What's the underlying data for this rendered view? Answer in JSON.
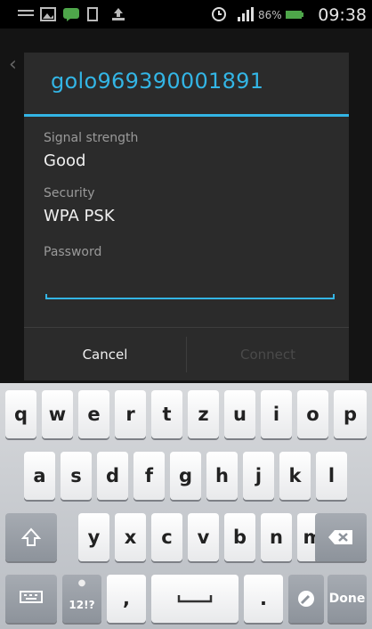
{
  "status_bar": {
    "battery_percent": "86%",
    "time": "09:38",
    "icons": [
      "notification-icon",
      "image-icon",
      "chat-icon",
      "sim-icon",
      "upload-icon",
      "alarm-icon",
      "signal-icon",
      "battery-icon"
    ]
  },
  "dialog": {
    "title": "golo969390001891",
    "signal_label": "Signal strength",
    "signal_value": "Good",
    "security_label": "Security",
    "security_value": "WPA PSK",
    "password_label": "Password",
    "password_value": "",
    "cancel_label": "Cancel",
    "connect_label": "Connect"
  },
  "keyboard": {
    "row1": [
      "q",
      "w",
      "e",
      "r",
      "t",
      "z",
      "u",
      "i",
      "o",
      "p"
    ],
    "row2": [
      "a",
      "s",
      "d",
      "f",
      "g",
      "h",
      "j",
      "k",
      "l"
    ],
    "row3": [
      "y",
      "x",
      "c",
      "v",
      "b",
      "n",
      "m"
    ],
    "symbols_label": "12!?",
    "comma": ",",
    "period": ".",
    "done_label": "Done"
  },
  "colors": {
    "accent": "#33b5e5",
    "dialog_bg": "#2b2b2b"
  }
}
